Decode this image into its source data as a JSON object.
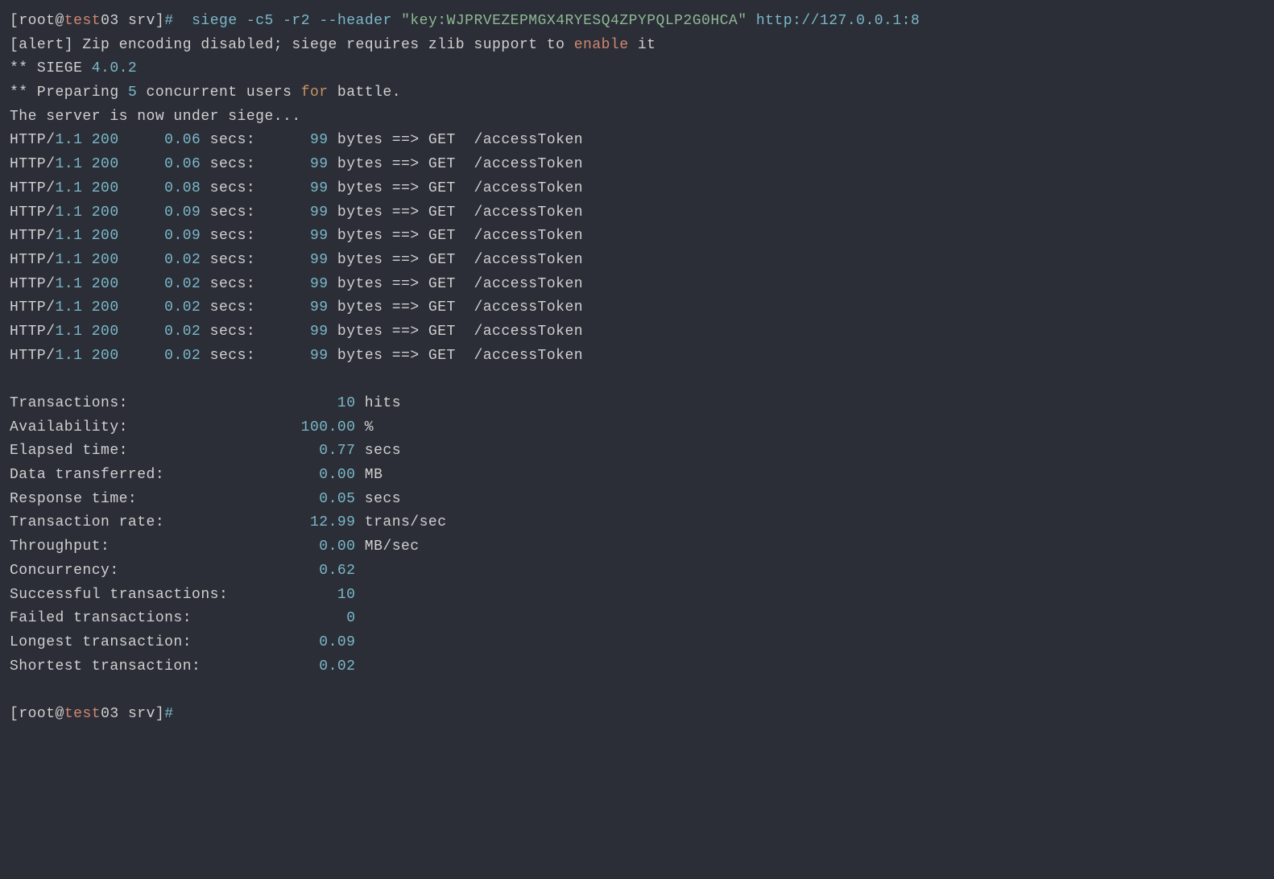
{
  "prompt": {
    "user_open": "[",
    "user_name": "root",
    "at": "@",
    "host": "test",
    "host_suffix": "03",
    "dir": " srv",
    "close": "]",
    "hash": "#  "
  },
  "command": {
    "siege": "siege ",
    "flags1": "-c5 -r2 --header ",
    "header_value": "\"key:WJPRVEZEPMGX4RYESQ4ZPYPQLP2G0HCA\"",
    "url": " http://127.0.0.1:8"
  },
  "alert_line": {
    "pre": "[alert] Zip encoding disabled; siege requires zlib support to ",
    "enable": "enable",
    "post": " it"
  },
  "siege_banner": {
    "stars": "** SIEGE ",
    "version": "4.0.2"
  },
  "preparing": {
    "pre": "** Preparing ",
    "count": "5",
    "mid": " concurrent users ",
    "forword": "for",
    "post": " battle."
  },
  "siege_start": "The server is now under siege...",
  "requests": [
    {
      "proto_pre": "HTTP/",
      "ver": "1.1",
      "status": " 200",
      "secs": "     0.06 ",
      "secs_label": "secs:",
      "bytes": "      99",
      "bytes_label": " bytes ==> GET  /accessToken"
    },
    {
      "proto_pre": "HTTP/",
      "ver": "1.1",
      "status": " 200",
      "secs": "     0.06 ",
      "secs_label": "secs:",
      "bytes": "      99",
      "bytes_label": " bytes ==> GET  /accessToken"
    },
    {
      "proto_pre": "HTTP/",
      "ver": "1.1",
      "status": " 200",
      "secs": "     0.08 ",
      "secs_label": "secs:",
      "bytes": "      99",
      "bytes_label": " bytes ==> GET  /accessToken"
    },
    {
      "proto_pre": "HTTP/",
      "ver": "1.1",
      "status": " 200",
      "secs": "     0.09 ",
      "secs_label": "secs:",
      "bytes": "      99",
      "bytes_label": " bytes ==> GET  /accessToken"
    },
    {
      "proto_pre": "HTTP/",
      "ver": "1.1",
      "status": " 200",
      "secs": "     0.09 ",
      "secs_label": "secs:",
      "bytes": "      99",
      "bytes_label": " bytes ==> GET  /accessToken"
    },
    {
      "proto_pre": "HTTP/",
      "ver": "1.1",
      "status": " 200",
      "secs": "     0.02 ",
      "secs_label": "secs:",
      "bytes": "      99",
      "bytes_label": " bytes ==> GET  /accessToken"
    },
    {
      "proto_pre": "HTTP/",
      "ver": "1.1",
      "status": " 200",
      "secs": "     0.02 ",
      "secs_label": "secs:",
      "bytes": "      99",
      "bytes_label": " bytes ==> GET  /accessToken"
    },
    {
      "proto_pre": "HTTP/",
      "ver": "1.1",
      "status": " 200",
      "secs": "     0.02 ",
      "secs_label": "secs:",
      "bytes": "      99",
      "bytes_label": " bytes ==> GET  /accessToken"
    },
    {
      "proto_pre": "HTTP/",
      "ver": "1.1",
      "status": " 200",
      "secs": "     0.02 ",
      "secs_label": "secs:",
      "bytes": "      99",
      "bytes_label": " bytes ==> GET  /accessToken"
    },
    {
      "proto_pre": "HTTP/",
      "ver": "1.1",
      "status": " 200",
      "secs": "     0.02 ",
      "secs_label": "secs:",
      "bytes": "      99",
      "bytes_label": " bytes ==> GET  /accessToken"
    }
  ],
  "stats": [
    {
      "label": "Transactions:",
      "pad": "                       ",
      "value": "10",
      "unit": " hits"
    },
    {
      "label": "Availability:",
      "pad": "                   ",
      "value": "100.00",
      "unit": " %"
    },
    {
      "label": "Elapsed time:",
      "pad": "                     ",
      "value": "0.77",
      "unit": " secs"
    },
    {
      "label": "Data transferred:",
      "pad": "                 ",
      "value": "0.00",
      "unit": " MB"
    },
    {
      "label": "Response time:",
      "pad": "                    ",
      "value": "0.05",
      "unit": " secs"
    },
    {
      "label": "Transaction rate:",
      "pad": "                ",
      "value": "12.99",
      "unit": " trans/sec"
    },
    {
      "label": "Throughput:",
      "pad": "                       ",
      "value": "0.00",
      "unit": " MB/sec"
    },
    {
      "label": "Concurrency:",
      "pad": "                      ",
      "value": "0.62",
      "unit": ""
    },
    {
      "label": "Successful transactions:",
      "pad": "            ",
      "value": "10",
      "unit": ""
    },
    {
      "label": "Failed transactions:",
      "pad": "                 ",
      "value": "0",
      "unit": ""
    },
    {
      "label": "Longest transaction:",
      "pad": "              ",
      "value": "0.09",
      "unit": ""
    },
    {
      "label": "Shortest transaction:",
      "pad": "             ",
      "value": "0.02",
      "unit": ""
    }
  ],
  "prompt_end": {
    "user_open": "[",
    "user_name": "root",
    "at": "@",
    "host": "test",
    "host_suffix": "03",
    "dir": " srv",
    "close": "]",
    "hash": "#"
  }
}
